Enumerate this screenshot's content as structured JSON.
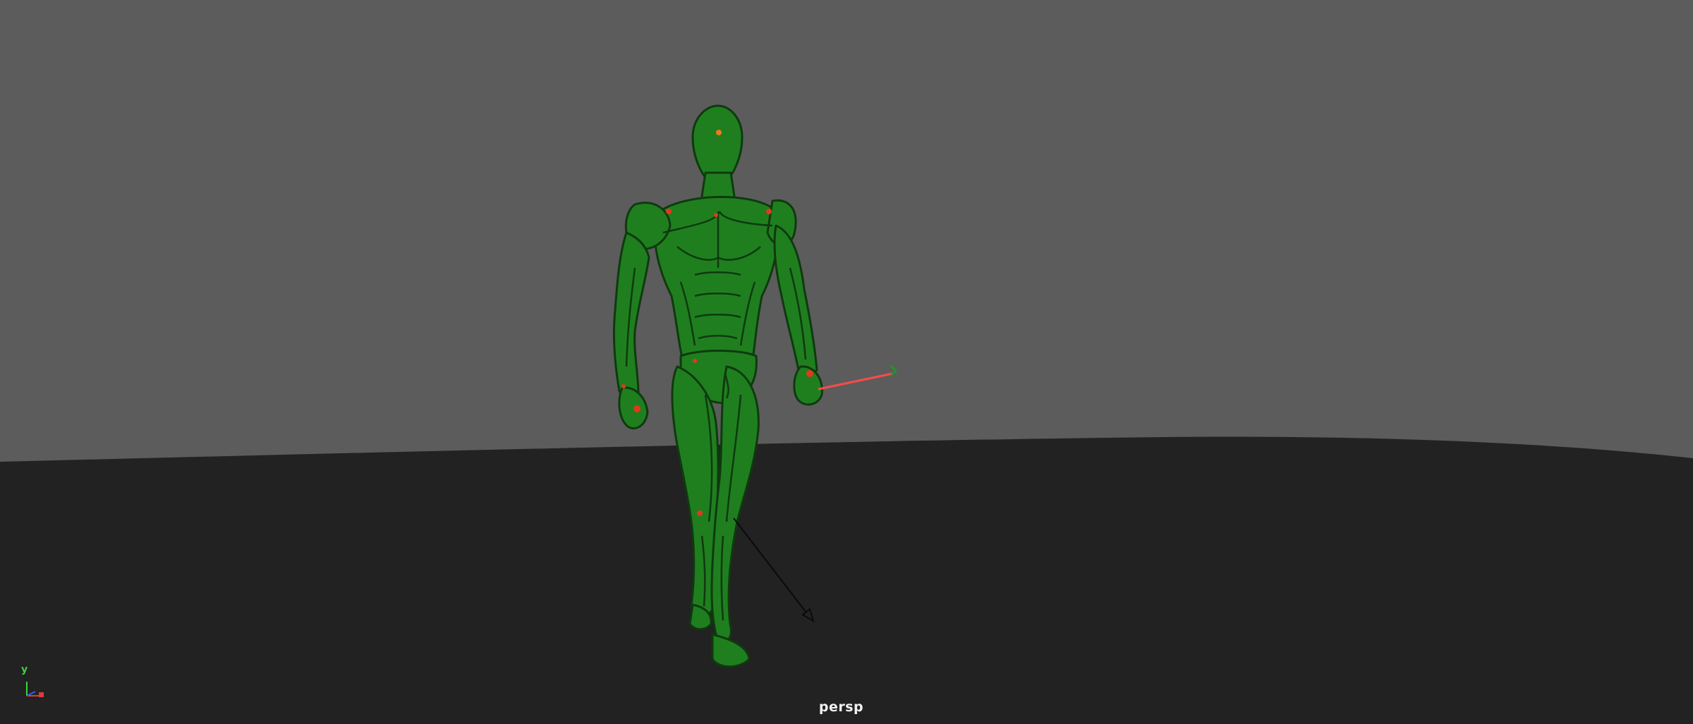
{
  "viewport": {
    "camera_name": "persp",
    "axis": {
      "y_label": "y"
    }
  },
  "colors": {
    "background_sky": "#5c5c5c",
    "ground_plane": "#222222",
    "character_body": "#1f7f1f",
    "character_outline": "#0f3a0f",
    "joint_highlight": "#e03a1a",
    "ik_handle": "#ff4a4a",
    "axis_y": "#3fd23f",
    "axis_x": "#e03a3a",
    "axis_z": "#3a5cff",
    "label_text": "#f2f2f2"
  },
  "icons": {
    "axis_gizmo": "view-axis-icon",
    "ik_handle": "ik-handle-icon",
    "pole_vector": "pole-vector-arrow-icon"
  }
}
